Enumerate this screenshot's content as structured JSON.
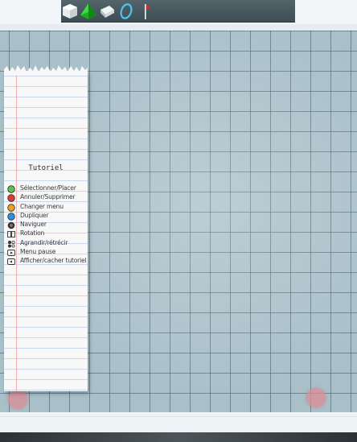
{
  "toolbar": {
    "tools": [
      {
        "icon": "white-cube-icon"
      },
      {
        "icon": "green-pyramid-icon"
      },
      {
        "icon": "gray-block-icon"
      },
      {
        "icon": "portal-ring-icon"
      },
      {
        "icon": "red-flag-icon"
      }
    ]
  },
  "tutorial": {
    "title": "Tutoriel",
    "items": [
      {
        "icon": "green-button-icon",
        "color": "#5cc24a",
        "label": "Sélectionner/Placer"
      },
      {
        "icon": "red-button-icon",
        "color": "#e03a32",
        "label": "Annuler/Supprimer"
      },
      {
        "icon": "orange-button-icon",
        "color": "#f0a020",
        "label": "Changer menu"
      },
      {
        "icon": "blue-button-icon",
        "color": "#2f8ee0",
        "label": "Dupliquer"
      },
      {
        "icon": "stick-button-icon",
        "color": "#333333",
        "label": "Naviguer"
      },
      {
        "icon": "shoulder-buttons-icon",
        "color": "#333333",
        "label": "Rotation"
      },
      {
        "icon": "dpad-icon",
        "color": "#333333",
        "label": "Agrandir/rétrécir"
      },
      {
        "icon": "start-button-icon",
        "color": "#333333",
        "label": "Menu pause"
      },
      {
        "icon": "select-button-icon",
        "color": "#333333",
        "label": "Afficher/cacher tutoriel"
      }
    ]
  },
  "colors": {
    "grid_background": "#a9c0c9",
    "grid_line": "#3c555f",
    "marker": "#dc8c96"
  }
}
